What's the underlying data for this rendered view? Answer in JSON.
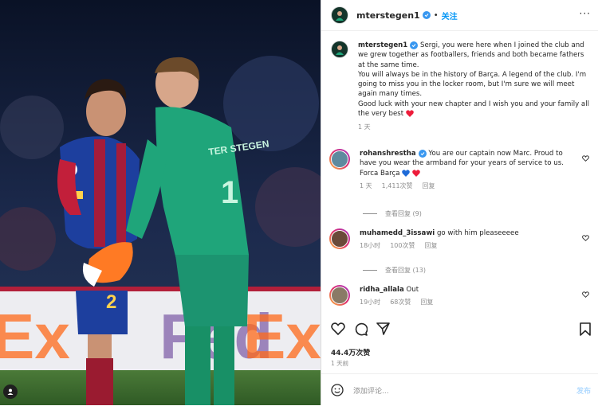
{
  "post": {
    "username": "mterstegen1",
    "follow_label": "关注",
    "more_label": "···"
  },
  "caption": {
    "username": "mterstegen1",
    "text": "Sergi, you were here when I joined the club and we grew together as footballers, friends and both became fathers at the same time.\nYou will always be in the history of Barça. A legend of the club. I'm going to miss you in the locker room, but I'm sure we will meet again many times.\nGood luck with your new chapter and I wish you and your family all the very best",
    "time": "1 天"
  },
  "comments": [
    {
      "username": "rohanshrestha",
      "text": "You are our captain now Marc. Proud to have you wear the armband for your years of service to us. Forca Barça",
      "time": "1 天",
      "likes": "1,411次赞",
      "reply": "回复",
      "view_replies": "查看回复 (9)"
    },
    {
      "username": "muhamedd_3issawi",
      "text": "go with him pleaseeeee",
      "time": "18小时",
      "likes": "100次赞",
      "reply": "回复",
      "view_replies": "查看回复 (13)"
    },
    {
      "username": "ridha_allala",
      "text": "Out",
      "time": "19小时",
      "likes": "68次赞",
      "reply": "回复"
    }
  ],
  "stats": {
    "likes": "44.4万次赞",
    "date": "1 天前"
  },
  "composer": {
    "placeholder": "添加评论...",
    "post_label": "发布"
  },
  "photo": {
    "jersey_number_left": "2",
    "jersey_number_right": "1",
    "jersey_name_right": "TER STEGEN",
    "board_text": "FedEx"
  },
  "colors": {
    "accent": "#0095f6",
    "verified": "#3897f0",
    "heart_red": "#ed1c3a",
    "heart_blue": "#1e6bd8",
    "keeper_green": "#1fa57a"
  }
}
